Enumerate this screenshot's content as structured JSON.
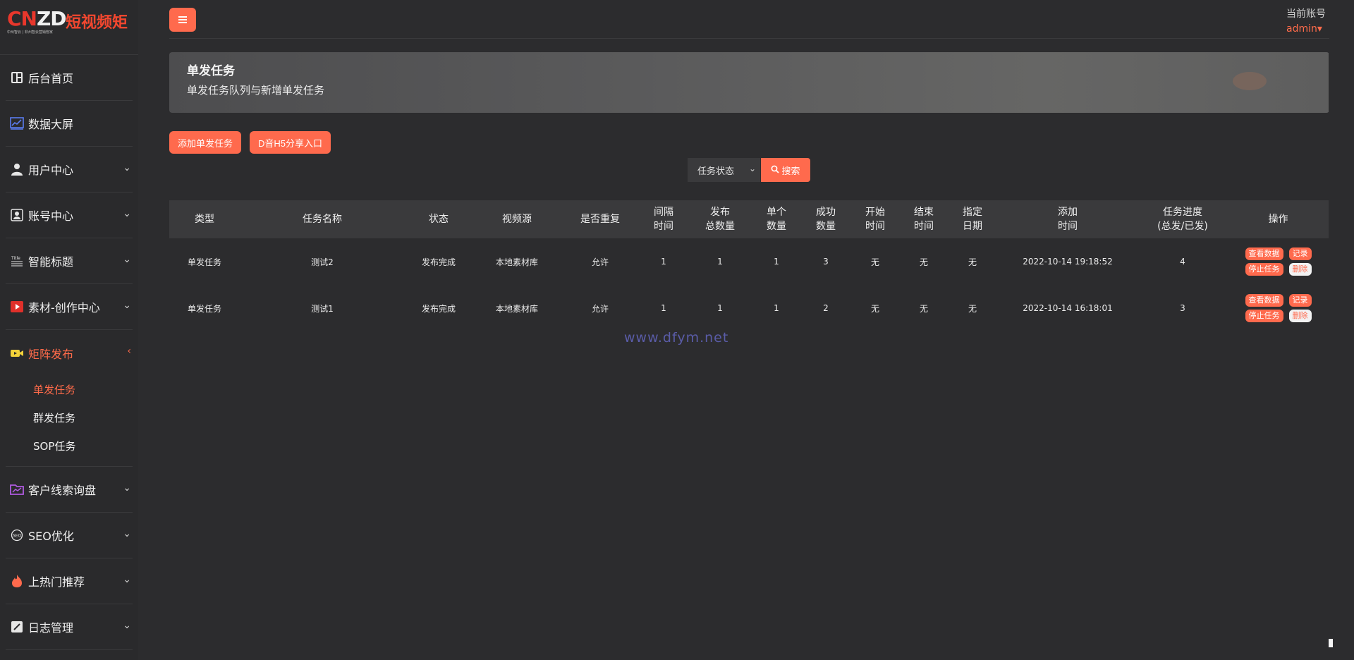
{
  "brand": {
    "mark_left": "CN",
    "mark_right": "ZD",
    "name": "短视频矩",
    "tagline": "中州智云 | 非州智云营销管家"
  },
  "sidebar": {
    "items": [
      {
        "label": "后台首页",
        "icon": "dashboard-icon"
      },
      {
        "label": "数据大屏",
        "icon": "chart-icon"
      },
      {
        "label": "用户中心",
        "icon": "user-icon"
      },
      {
        "label": "账号中心",
        "icon": "account-icon"
      },
      {
        "label": "智能标题",
        "icon": "title-icon"
      },
      {
        "label": "素材-创作中心",
        "icon": "play-icon"
      },
      {
        "label": "矩阵发布",
        "icon": "video-icon"
      },
      {
        "label": "客户线索询盘",
        "icon": "folder-icon"
      },
      {
        "label": "SEO优化",
        "icon": "seo-icon"
      },
      {
        "label": "上热门推荐",
        "icon": "fire-icon"
      },
      {
        "label": "日志管理",
        "icon": "log-icon"
      }
    ],
    "submenu": [
      "单发任务",
      "群发任务",
      "SOP任务"
    ],
    "colors": {
      "accent": "#ff6b4a"
    }
  },
  "header": {
    "account_label": "当前账号",
    "account_user": "admin▾"
  },
  "banner": {
    "title": "单发任务",
    "subtitle": "单发任务队列与新增单发任务"
  },
  "actions": {
    "add_task": "添加单发任务",
    "h5_entry": "D音H5分享入口"
  },
  "filter": {
    "status_select": "任务状态",
    "search": "搜索"
  },
  "table": {
    "headers": [
      [
        "类型"
      ],
      [
        "任务名称"
      ],
      [
        "状态"
      ],
      [
        "视频源"
      ],
      [
        "是否重复"
      ],
      [
        "间隔",
        "时间"
      ],
      [
        "发布",
        "总数量"
      ],
      [
        "单个",
        "数量"
      ],
      [
        "成功",
        "数量"
      ],
      [
        "开始",
        "时间"
      ],
      [
        "结束",
        "时间"
      ],
      [
        "指定",
        "日期"
      ],
      [
        "添加",
        "时间"
      ],
      [
        "任务进度",
        "(总发/已发)"
      ],
      [
        "操作"
      ]
    ],
    "rows": [
      [
        "单发任务",
        "测试2",
        "发布完成",
        "本地素材库",
        "允许",
        "1",
        "1",
        "1",
        "3",
        "无",
        "无",
        "无",
        "2022-10-14 19:18:52",
        "4"
      ],
      [
        "单发任务",
        "测试1",
        "发布完成",
        "本地素材库",
        "允许",
        "1",
        "1",
        "1",
        "2",
        "无",
        "无",
        "无",
        "2022-10-14 16:18:01",
        "3"
      ]
    ],
    "ops": {
      "view_data": "查看数据",
      "records": "记录",
      "stop": "停止任务",
      "delete": "删除"
    }
  },
  "watermark": "www.dfym.net"
}
